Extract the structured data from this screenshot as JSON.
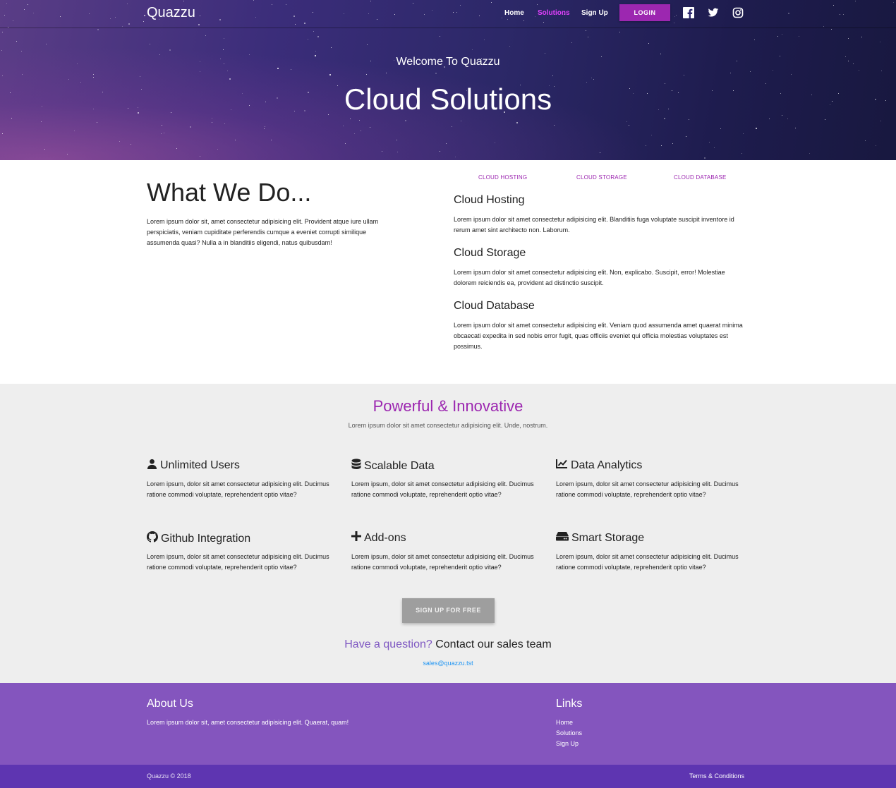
{
  "nav": {
    "brand": "Quazzu",
    "links": [
      {
        "label": "Home"
      },
      {
        "label": "Solutions"
      },
      {
        "label": "Sign Up"
      }
    ],
    "active_link": "Solutions",
    "login_label": "LOGIN",
    "social_icons": [
      "facebook-icon",
      "twitter-icon",
      "instagram-icon"
    ]
  },
  "hero": {
    "subtitle": "Welcome To Quazzu",
    "title": "Cloud Solutions"
  },
  "what_we_do": {
    "title": "What We Do...",
    "text": "Lorem ipsum dolor sit, amet consectetur adipisicing elit. Provident atque iure ullam perspiciatis, veniam cupiditate perferendis cumque a eveniet corrupti similique assumenda quasi? Nulla a in blanditiis eligendi, natus quibusdam!"
  },
  "tabs": [
    {
      "label": "CLOUD HOSTING"
    },
    {
      "label": "CLOUD STORAGE"
    },
    {
      "label": "CLOUD DATABASE"
    }
  ],
  "services": [
    {
      "title": "Cloud Hosting",
      "text": "Lorem ipsum dolor sit amet consectetur adipisicing elit. Blanditiis fuga voluptate suscipit inventore id rerum amet sint architecto non. Laborum."
    },
    {
      "title": "Cloud Storage",
      "text": "Lorem ipsum dolor sit amet consectetur adipisicing elit. Non, explicabo. Suscipit, error! Molestiae dolorem reiciendis ea, provident ad distinctio suscipit."
    },
    {
      "title": "Cloud Database",
      "text": "Lorem ipsum dolor sit amet consectetur adipisicing elit. Veniam quod assumenda amet quaerat minima obcaecati expedita in sed nobis error fugit, quas officiis eveniet qui officia molestias voluptates est possimus."
    }
  ],
  "features": {
    "heading": "Powerful & Innovative",
    "subheading": "Lorem ipsum dolor sit amet consectetur adipisicing elit. Unde, nostrum.",
    "items": [
      {
        "title": "Unlimited Users",
        "icon": "user-icon",
        "text": "Lorem ipsum, dolor sit amet consectetur adipisicing elit. Ducimus ratione commodi voluptate, reprehenderit optio vitae?"
      },
      {
        "title": "Scalable Data",
        "icon": "database-icon",
        "text": "Lorem ipsum, dolor sit amet consectetur adipisicing elit. Ducimus ratione commodi voluptate, reprehenderit optio vitae?"
      },
      {
        "title": "Data Analytics",
        "icon": "chart-line-icon",
        "text": "Lorem ipsum, dolor sit amet consectetur adipisicing elit. Ducimus ratione commodi voluptate, reprehenderit optio vitae?"
      },
      {
        "title": "Github Integration",
        "icon": "github-icon",
        "text": "Lorem ipsum, dolor sit amet consectetur adipisicing elit. Ducimus ratione commodi voluptate, reprehenderit optio vitae?"
      },
      {
        "title": "Add-ons",
        "icon": "plus-icon",
        "text": "Lorem ipsum, dolor sit amet consectetur adipisicing elit. Ducimus ratione commodi voluptate, reprehenderit optio vitae?"
      },
      {
        "title": "Smart Storage",
        "icon": "hdd-icon",
        "text": "Lorem ipsum, dolor sit amet consectetur adipisicing elit. Ducimus ratione commodi voluptate, reprehenderit optio vitae?"
      }
    ],
    "signup_label": "SIGN UP FOR FREE",
    "question_highlight": "Have a question?",
    "question_rest": "Contact our sales team",
    "email": "sales@quazzu.tst"
  },
  "footer": {
    "about_title": "About Us",
    "about_text": "Lorem ipsum dolor sit, amet consectetur adipisicing elit. Quaerat, quam!",
    "links_title": "Links",
    "links": [
      "Home",
      "Solutions",
      "Sign Up"
    ],
    "copyright": "Quazzu © 2018",
    "terms": "Terms & Conditions"
  },
  "colors": {
    "accent": "#9c27b0",
    "footer": "#8455be",
    "bottom_bar": "#5e35b1",
    "features_bg": "#eeeeee",
    "question": "#7e57c2",
    "email": "#2196f3"
  }
}
